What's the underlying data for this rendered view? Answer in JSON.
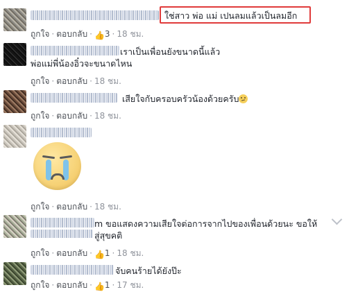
{
  "actions": {
    "like": "ถูกใจ",
    "reply": "ตอบกลับ",
    "sep": "·"
  },
  "comments": [
    {
      "text": "ใช่สาว พ่อ แม่ เปนลมแล้วเป็นลมอีก",
      "likes": "3",
      "time": "18 ชม."
    },
    {
      "line1": "เราเป็นเพื่อนยังขนาดนี้แล้ว",
      "line2": "พ่อแม่พี่น้องอิ๋วจะขนาดไหน",
      "time": "18 ชม."
    },
    {
      "text": "เสียใจกับครอบครัวน้องด้วยครับ",
      "time": "18 ชม."
    },
    {
      "time": "18 ชม."
    },
    {
      "line1": "m ขอแสดงความเสียใจต่อการจากไปของเพื่อนด้วยนะ ขอให้",
      "line2": "สู่สุขคติ",
      "likes": "1",
      "time": "18 ชม."
    },
    {
      "text": "จับคนร้ายได้ยังป๊ะ",
      "likes": "1",
      "time": "17 ชม."
    }
  ],
  "colors": {
    "highlight": "#e03a3a",
    "like_blue": "#5890ff",
    "meta_gray": "#90949c"
  },
  "icons": {
    "like": "thumbs-up-icon",
    "sticker": "crying-face-sticker",
    "emoji": "confused-face-icon",
    "menu": "chevron-down-icon"
  }
}
